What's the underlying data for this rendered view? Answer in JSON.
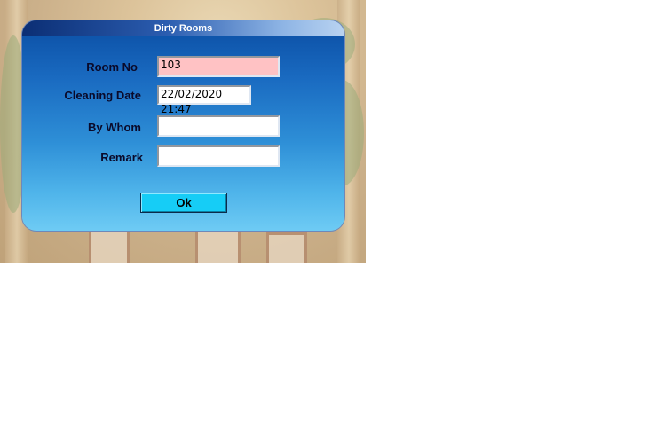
{
  "dialog": {
    "title": "Dirty Rooms",
    "room_no": {
      "label": "Room No",
      "value": "103"
    },
    "cleaning_date": {
      "label": "Cleaning Date",
      "value": "22/02/2020 21:47"
    },
    "by_whom": {
      "label": "By Whom",
      "value": ""
    },
    "remark": {
      "label": "Remark",
      "value": ""
    },
    "ok_button": {
      "mnemonic": "O",
      "rest": "k"
    }
  },
  "colors": {
    "title_gradient_start": "#0b2e74",
    "dialog_top": "#0a4da3",
    "dialog_bottom": "#6ecbf4",
    "room_no_field": "#ffc2c4",
    "ok_button": "#16cdf6"
  }
}
